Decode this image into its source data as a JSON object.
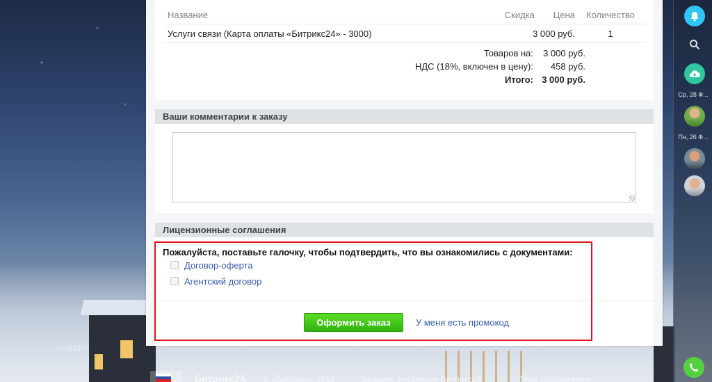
{
  "order": {
    "columns": {
      "name": "Название",
      "discount": "Скидка",
      "price": "Цена",
      "quantity": "Количество"
    },
    "items": [
      {
        "name": "Услуги связи (Карта оплаты «Битрикс24» - 3000)",
        "discount": "",
        "price": "3 000 руб.",
        "quantity": "1"
      }
    ],
    "totals": {
      "goods_label": "Товаров на:",
      "goods_value": "3 000 руб.",
      "vat_label": "НДС (18%, включен в цену):",
      "vat_value": "458 руб.",
      "total_label": "Итого:",
      "total_value": "3 000 руб."
    }
  },
  "comments": {
    "title": "Ваши комментарии к заказу",
    "value": ""
  },
  "license": {
    "title": "Лицензионные соглашения",
    "prompt": "Пожалуйста, поставьте галочку, чтобы подтвердить, что вы ознакомились с документами:",
    "documents": [
      {
        "label": "Договор-оферта",
        "checked": false
      },
      {
        "label": "Агентский договор",
        "checked": false
      }
    ],
    "submit_label": "Оформить заказ",
    "promo_label": "У меня есть промокод"
  },
  "nav": {
    "up_label": "НАВЕРХ"
  },
  "footer": {
    "brand": "Битрикс24",
    "copyright": "© «Битрикс», 2018",
    "order_link": "Заказать внедрение Битрикс24",
    "theme_link": "Тема оформления"
  },
  "sidebar": {
    "date1": "Ср, 28 Ф...",
    "date2": "Пн, 26 Ф..."
  },
  "colors": {
    "accent": "#2fc6f6",
    "submit": "#3cc71a",
    "link": "#3a5ba9",
    "highlight": "#e0141b"
  }
}
